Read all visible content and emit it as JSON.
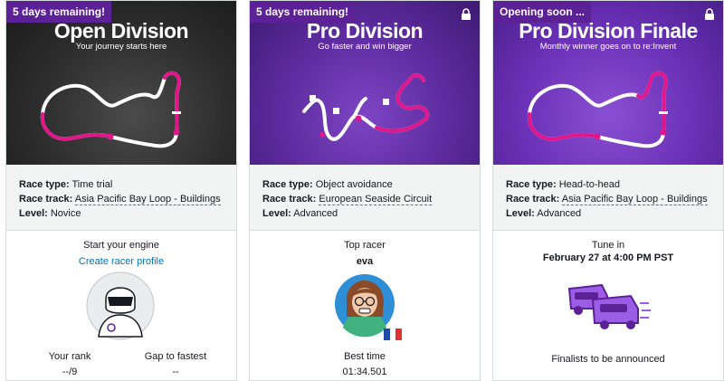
{
  "cards": [
    {
      "badge": "5 days remaining!",
      "title": "Open Division",
      "subtitle": "Your journey starts here",
      "race_type_label": "Race type:",
      "race_type": "Time trial",
      "race_track_label": "Race track:",
      "race_track": "Asia Pacific Bay Loop - Buildings",
      "level_label": "Level:",
      "level": "Novice",
      "heading": "Start your engine",
      "link": "Create racer profile",
      "rank_label": "Your rank",
      "rank_value": "--/9",
      "gap_label": "Gap to fastest",
      "gap_value": "--"
    },
    {
      "badge": "5 days remaining!",
      "title": "Pro Division",
      "subtitle": "Go faster and win bigger",
      "race_type_label": "Race type:",
      "race_type": "Object avoidance",
      "race_track_label": "Race track:",
      "race_track": "European Seaside Circuit",
      "level_label": "Level:",
      "level": "Advanced",
      "heading": "Top racer",
      "racer_name": "eva",
      "best_time_label": "Best time",
      "best_time": "01:34.501"
    },
    {
      "badge": "Opening soon ...",
      "title": "Pro Division Finale",
      "subtitle": "Monthly winner goes on to re:Invent",
      "race_type_label": "Race type:",
      "race_type": "Head-to-head",
      "race_track_label": "Race track:",
      "race_track": "Asia Pacific Bay Loop - Buildings",
      "level_label": "Level:",
      "level": "Advanced",
      "heading": "Tune in",
      "date": "February 27 at 4:00 PM PST",
      "footer": "Finalists to be announced"
    }
  ],
  "icons": {
    "lock": "lock-icon",
    "helmet": "racer-helmet-avatar",
    "person": "racer-avatar",
    "flag": "france-flag-icon",
    "cars": "racing-cars-icon"
  },
  "colors": {
    "badge_bg": "#5c2196",
    "track_pink": "#e0168b",
    "link": "#0073bb"
  }
}
